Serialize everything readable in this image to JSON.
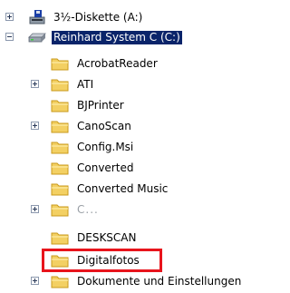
{
  "tree": {
    "root_items": [
      {
        "label": "3½-Diskette (A:)",
        "icon": "floppy-drive-icon",
        "expander": "plus"
      },
      {
        "label": "Reinhard System C (C:)",
        "icon": "hard-drive-icon",
        "expander": "minus",
        "selected": true
      }
    ],
    "folders": [
      {
        "label": "AcrobatReader",
        "expander": null
      },
      {
        "label": "ATI",
        "expander": "plus"
      },
      {
        "label": "BJPrinter",
        "expander": null
      },
      {
        "label": "CanoScan",
        "expander": "plus"
      },
      {
        "label": "Config.Msi",
        "expander": null
      },
      {
        "label": "Converted",
        "expander": null
      },
      {
        "label": "Converted Music",
        "expander": null
      },
      {
        "label": "C...",
        "expander": "plus",
        "obscured": true
      },
      {
        "label": "DESKSCAN",
        "expander": null
      },
      {
        "label": "Digitalfotos",
        "expander": null,
        "highlighted": true
      },
      {
        "label": "Dokumente und Einstellungen",
        "expander": "plus"
      }
    ]
  },
  "colors": {
    "selection": "#0a246a",
    "highlight_box": "#e8141c",
    "folder": "#f3d063"
  }
}
